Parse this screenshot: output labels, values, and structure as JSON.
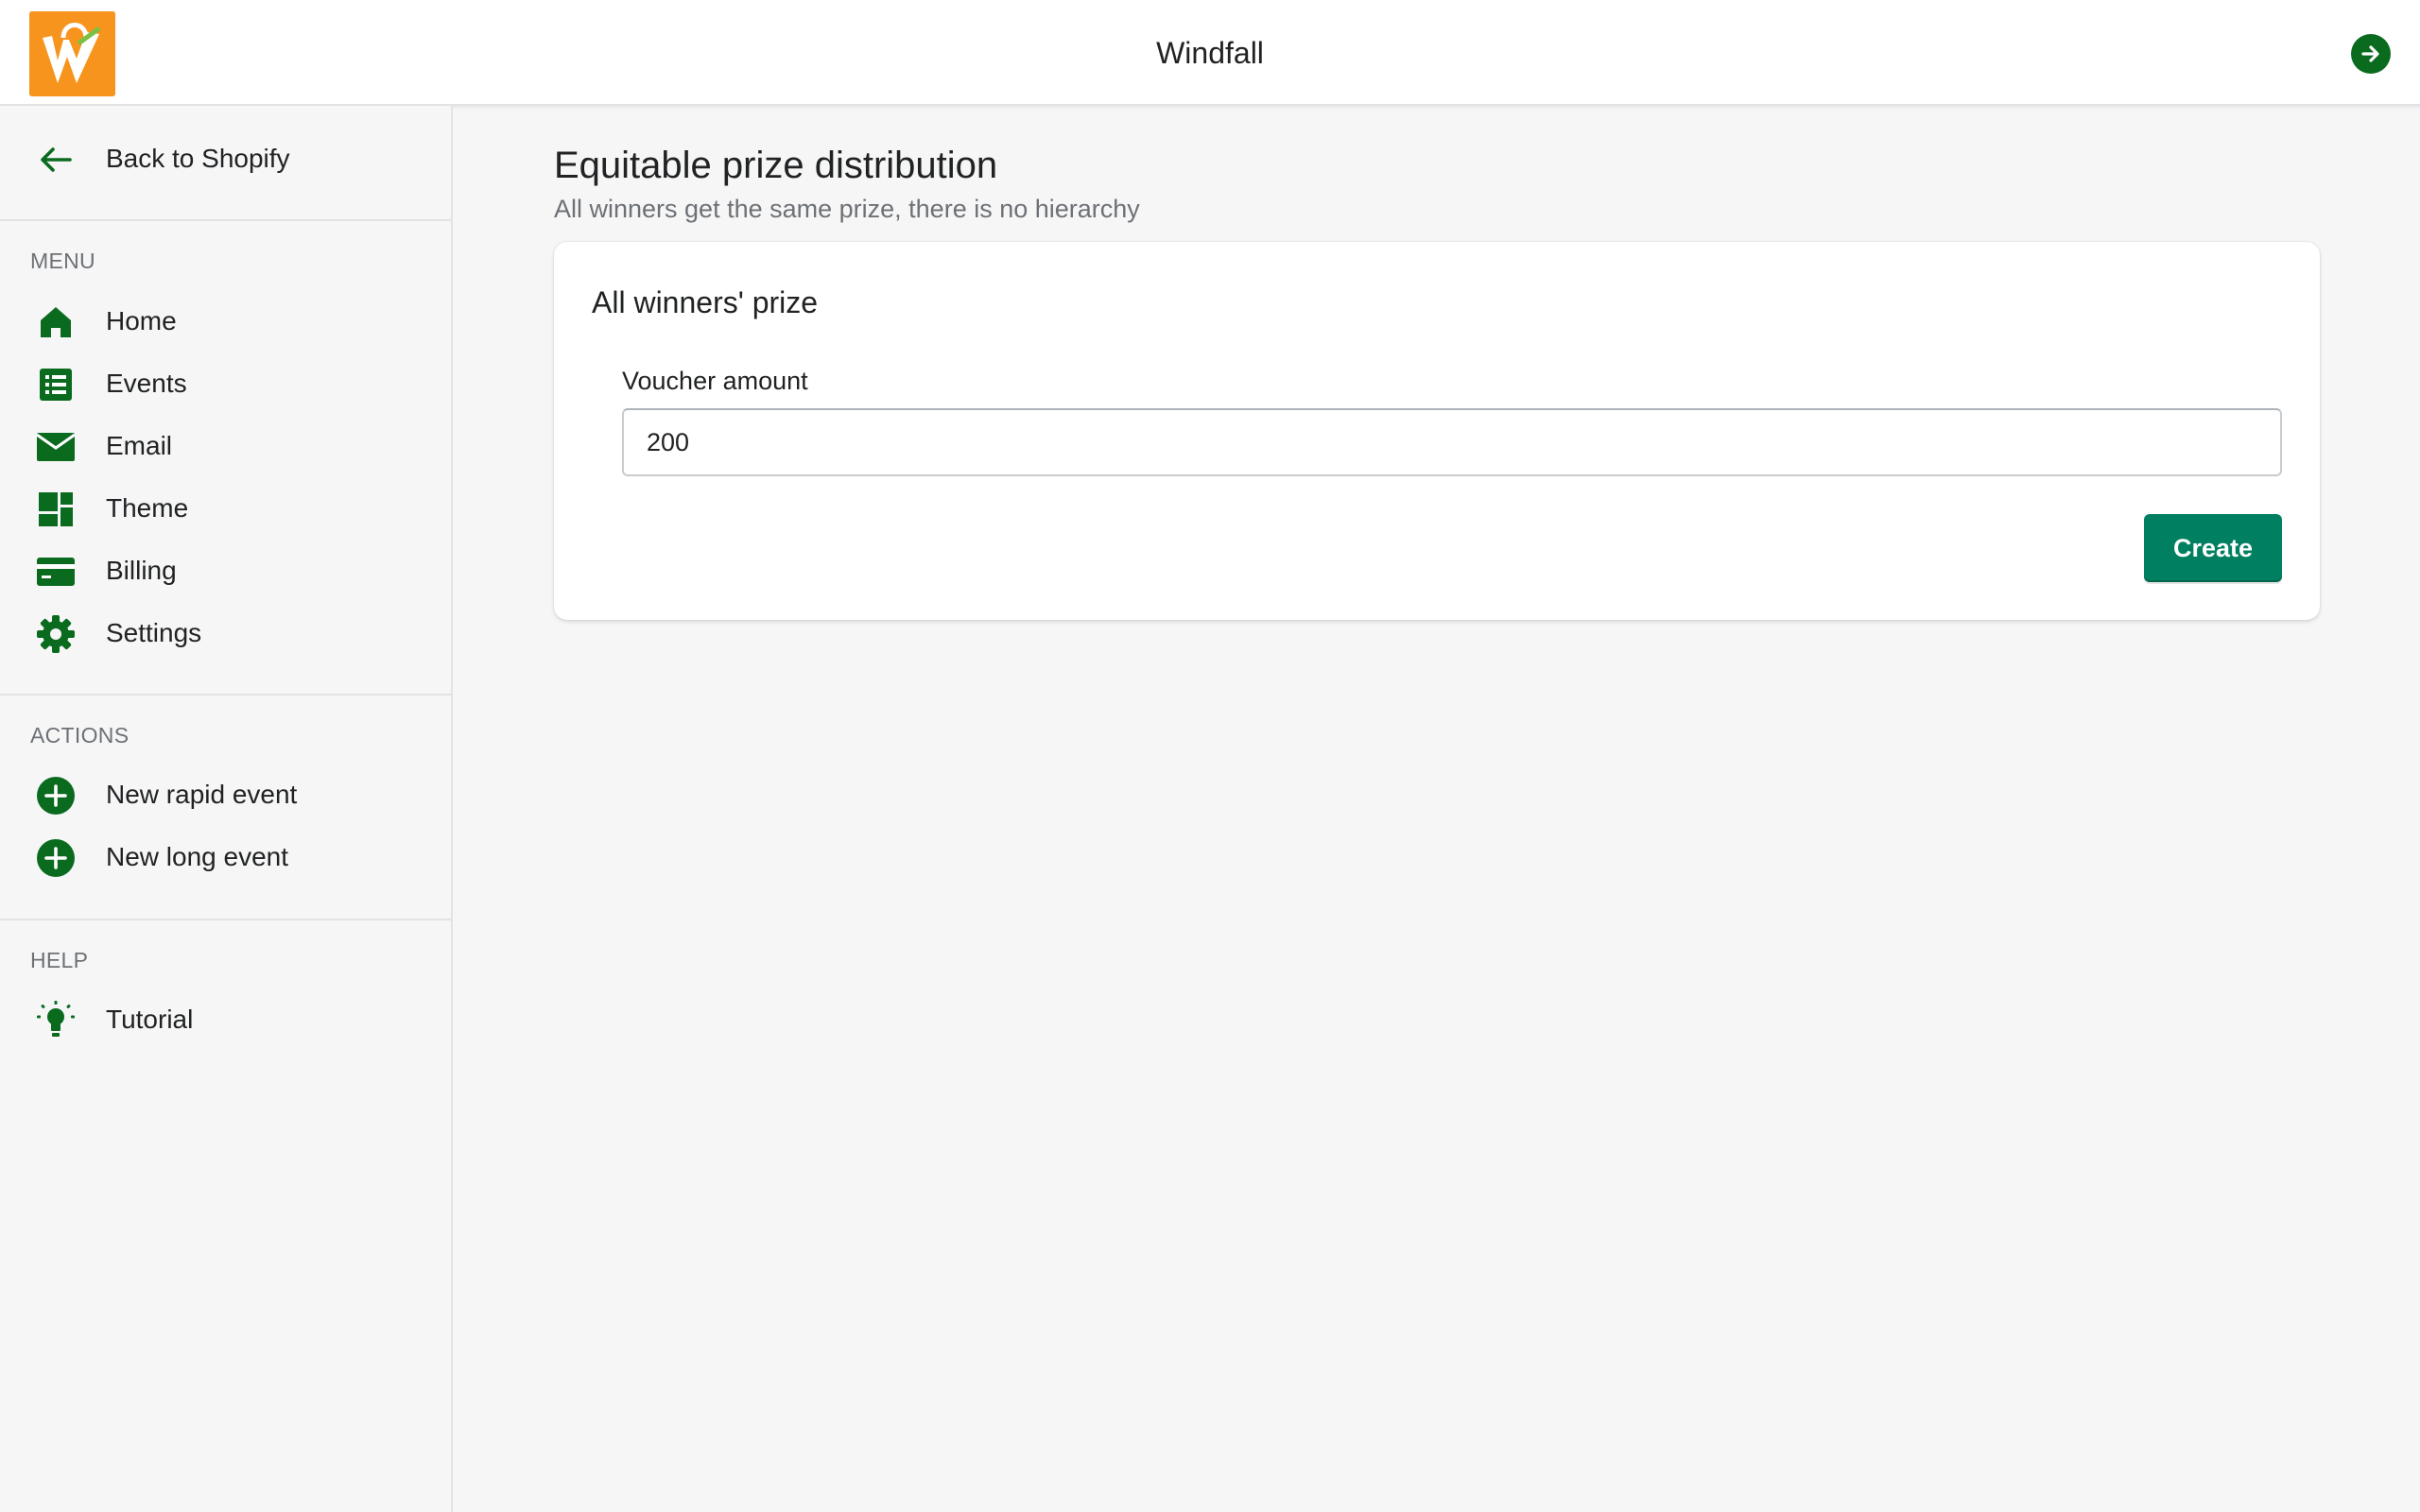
{
  "app": {
    "title": "Windfall",
    "logo_icon": "windfall-bag-logo",
    "exit_icon": "arrow-right-circle-icon"
  },
  "colors": {
    "accent_green": "#0a6b1f",
    "primary_button": "#008060",
    "logo_orange": "#f7941d"
  },
  "sidebar": {
    "back_label": "Back to Shopify",
    "menu_title": "MENU",
    "menu_items": [
      {
        "label": "Home",
        "icon": "home-icon"
      },
      {
        "label": "Events",
        "icon": "list-icon"
      },
      {
        "label": "Email",
        "icon": "envelope-icon"
      },
      {
        "label": "Theme",
        "icon": "layout-icon"
      },
      {
        "label": "Billing",
        "icon": "credit-card-icon"
      },
      {
        "label": "Settings",
        "icon": "gear-icon"
      }
    ],
    "actions_title": "ACTIONS",
    "action_items": [
      {
        "label": "New rapid event",
        "icon": "plus-circle-icon"
      },
      {
        "label": "New long event",
        "icon": "plus-circle-icon"
      }
    ],
    "help_title": "HELP",
    "help_items": [
      {
        "label": "Tutorial",
        "icon": "lightbulb-icon"
      }
    ]
  },
  "main": {
    "title": "Equitable prize distribution",
    "subtitle": "All winners get the same prize, there is no hierarchy",
    "card": {
      "title": "All winners' prize",
      "field_label": "Voucher amount",
      "field_value": "200",
      "button_label": "Create"
    }
  }
}
